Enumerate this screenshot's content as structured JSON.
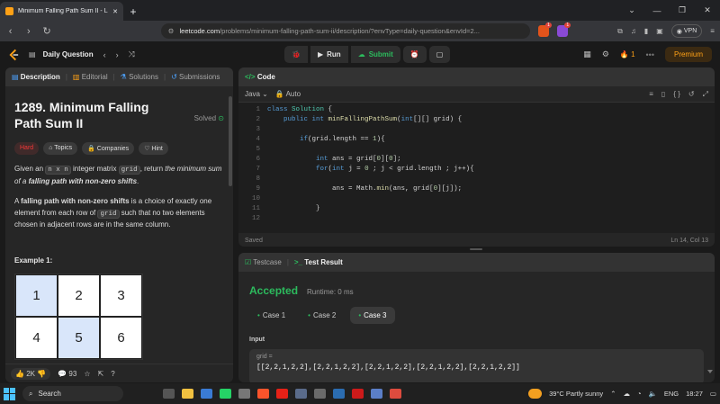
{
  "browser": {
    "tab_title": "Minimum Falling Path Sum II - L",
    "url_domain": "leetcode.com",
    "url_path": "/problems/minimum-falling-path-sum-ii/description/?envType=daily-question&envId=2...",
    "shield_badge": "1",
    "alert_badge": "1",
    "vpn_label": "VPN"
  },
  "header": {
    "daily_label": "Daily Question",
    "run_label": "Run",
    "submit_label": "Submit",
    "streak": "1",
    "premium_label": "Premium"
  },
  "left_tabs": [
    "Description",
    "Editorial",
    "Solutions",
    "Submissions"
  ],
  "problem": {
    "title": "1289. Minimum Falling Path Sum II",
    "solved_label": "Solved",
    "tags": [
      "Hard",
      "Topics",
      "Companies",
      "Hint"
    ],
    "p1_a": "Given an ",
    "p1_code1": "n x n",
    "p1_b": " integer matrix ",
    "p1_code2": "grid",
    "p1_c": ", return ",
    "p1_em": "the minimum sum of a ",
    "p1_bold": "falling path with non-zero shifts",
    "p1_end": ".",
    "p2_a": "A ",
    "p2_bold": "falling path with non-zero shifts",
    "p2_b": " is a choice of exactly one element from each row of ",
    "p2_code": "grid",
    "p2_c": " such that no two elements chosen in adjacent rows are in the same column.",
    "example_label": "Example 1:",
    "grid_cells": [
      "1",
      "2",
      "3",
      "4",
      "5",
      "6"
    ]
  },
  "left_footer": {
    "likes": "2K",
    "comments": "93"
  },
  "code_panel": {
    "title": "Code",
    "language": "Java",
    "mode": "Auto",
    "line_numbers": [
      "1",
      "2",
      "3",
      "4",
      "5",
      "6",
      "7",
      "8",
      "9",
      "10",
      "11",
      "12"
    ],
    "status": "Saved",
    "cursor": "Ln 14, Col 13"
  },
  "result_panel": {
    "testcase_tab": "Testcase",
    "result_tab": "Test Result",
    "status": "Accepted",
    "runtime": "Runtime: 0 ms",
    "cases": [
      "Case 1",
      "Case 2",
      "Case 3"
    ],
    "input_label": "Input",
    "grid_label": "grid =",
    "grid_value": "[[2,2,1,2,2],[2,2,1,2,2],[2,2,1,2,2],[2,2,1,2,2],[2,2,1,2,2]]"
  },
  "taskbar": {
    "search_label": "Search",
    "weather": "39°C  Partly sunny",
    "language": "ENG",
    "time": "18:27"
  }
}
